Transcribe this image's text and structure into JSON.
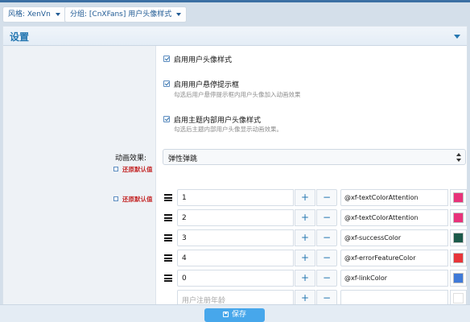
{
  "breadcrumbs": [
    {
      "label": "风格:",
      "value": "XenVn"
    },
    {
      "label": "分组:",
      "value": "[CnXFans] 用户头像样式"
    }
  ],
  "panel": {
    "title": "设置"
  },
  "options": [
    {
      "label": "启用用户头像样式",
      "hint": "",
      "checked": true
    },
    {
      "label": "启用用户悬停提示框",
      "hint": "勾选后用户悬停提示框内用户头像加入动画效果",
      "checked": true
    },
    {
      "label": "启用主题内部用户头像样式",
      "hint": "勾选后主题内部用户头像显示动画效果。",
      "checked": true
    }
  ],
  "animation": {
    "label": "动画效果:",
    "reset_label": "还原默认值",
    "selected": "弹性弹跳"
  },
  "colors_reset_label": "还原默认值",
  "color_rows": [
    {
      "value": "1",
      "color_name": "@xf-textColorAttention",
      "swatch": "#e8327a"
    },
    {
      "value": "2",
      "color_name": "@xf-textColorAttention",
      "swatch": "#e8327a"
    },
    {
      "value": "3",
      "color_name": "@xf-successColor",
      "swatch": "#1c5a4a"
    },
    {
      "value": "4",
      "color_name": "@xf-errorFeatureColor",
      "swatch": "#e8353a"
    },
    {
      "value": "0",
      "color_name": "@xf-linkColor",
      "swatch": "#3f7ad8"
    },
    {
      "value": "",
      "placeholder": "用户注册年龄",
      "color_name": "",
      "swatch": "#ffffff"
    }
  ],
  "step_plus": "+",
  "step_minus": "−",
  "footer": {
    "save_label": "保存"
  }
}
